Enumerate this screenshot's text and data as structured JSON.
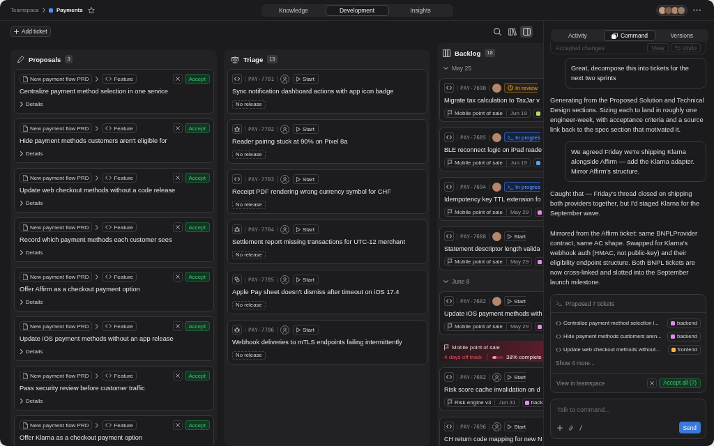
{
  "topbar": {
    "breadcrumb": [
      {
        "label": "Teamspace"
      },
      {
        "label": "Payments"
      }
    ],
    "starred": false,
    "tabs": [
      {
        "label": "Knowledge",
        "selected": false
      },
      {
        "label": "Development",
        "selected": true
      },
      {
        "label": "Insights",
        "selected": false
      }
    ]
  },
  "toolbar": {
    "add_ticket": "Add ticket",
    "panel_open": true
  },
  "columns": [
    {
      "kind": "proposals",
      "title": "Proposals",
      "count": "3",
      "cards": [
        {
          "source": "New payment flow PRD",
          "type": "Feature",
          "accept": "Accept",
          "title": "Centralize payment method selection in one service",
          "details": "Details",
          "expanded": false
        },
        {
          "source": "New payment flow PRD",
          "type": "Feature",
          "accept": "Accept",
          "title": "Hide payment methods customers aren't eligible for",
          "details": "Details",
          "expanded": false
        },
        {
          "source": "New payment flow PRD",
          "type": "Feature",
          "accept": "Accept",
          "title": "Update web checkout methods without a code release",
          "details": "Details",
          "expanded": false
        },
        {
          "source": "New payment flow PRD",
          "type": "Feature",
          "accept": "Accept",
          "title": "Record which payment methods each customer sees",
          "details": "Details",
          "expanded": false
        },
        {
          "source": "New payment flow PRD",
          "type": "Feature",
          "accept": "Accept",
          "title": "Offer Affirm as a checkout payment option",
          "details": "Details",
          "expanded": false
        },
        {
          "source": "New payment flow PRD",
          "type": "Feature",
          "accept": "Accept",
          "title": "Update iOS payment methods without an app release",
          "details": "Details",
          "expanded": false
        },
        {
          "source": "New payment flow PRD",
          "type": "Feature",
          "accept": "Accept",
          "title": "Pass security review before customer traffic",
          "details": "Details",
          "expanded": false
        },
        {
          "source": "New payment flow PRD",
          "type": "Feature",
          "accept": "Accept",
          "title": "Offer Klarna as a checkout payment option"
        }
      ]
    },
    {
      "kind": "triage",
      "title": "Triage",
      "count": "15",
      "cards": [
        {
          "kind": "feature",
          "id": "PAY-7701",
          "assigned": false,
          "status": {
            "kind": "start",
            "label": "Start"
          },
          "title": "Sync notification dashboard actions with app icon badge",
          "release": "No release"
        },
        {
          "kind": "bug",
          "id": "PAY-7702",
          "assigned": false,
          "status": {
            "kind": "start",
            "label": "Start"
          },
          "title": "Reader pairing stuck at 90% on Pixel 8a",
          "release": "No release"
        },
        {
          "kind": "feature",
          "id": "PAY-7703",
          "assigned": false,
          "status": {
            "kind": "start",
            "label": "Start"
          },
          "title": "Receipt PDF rendering wrong currency symbol for CHF",
          "release": "No release"
        },
        {
          "kind": "bug",
          "id": "PAY-7704",
          "assigned": false,
          "status": {
            "kind": "start",
            "label": "Start"
          },
          "title": "Settlement report missing transactions for UTC-12 merchant",
          "release": "No release"
        },
        {
          "kind": "chore",
          "id": "PAY-7705",
          "assigned": false,
          "status": {
            "kind": "start",
            "label": "Start"
          },
          "title": "Apple Pay sheet doesn't dismiss after timeout on iOS 17.4",
          "release": "No release"
        },
        {
          "kind": "bug",
          "id": "PAY-7706",
          "assigned": false,
          "status": {
            "kind": "start",
            "label": "Start"
          },
          "title": "Webhook deliveries to mTLS endpoints failing intermittently",
          "release": "No release"
        }
      ]
    },
    {
      "kind": "backlog",
      "title": "Backlog",
      "count": "18",
      "groups": [
        {
          "label": "May 25",
          "expanded": true,
          "items": [
            {
              "kind": "feature",
              "id": "PAY-7690",
              "assigned": true,
              "status": {
                "kind": "review",
                "label": "In review"
              },
              "title": "Migrate tax calculation to TaxJar v",
              "milestone": {
                "name": "Mobile point of sale",
                "date": "Jun 19"
              },
              "tag": {
                "color": "#b9dc6e"
              }
            },
            {
              "kind": "feature",
              "id": "PAY-7685",
              "assigned": true,
              "status": {
                "kind": "progress",
                "label": "In progres"
              },
              "title": "BLE reconnect logic on iPad reade",
              "milestone": {
                "name": "Mobile point of sale",
                "date": "Jun 19"
              },
              "tag": {
                "color": "#5b9df7"
              }
            },
            {
              "kind": "feature",
              "id": "PAY-7694",
              "assigned": true,
              "status": {
                "kind": "progress",
                "label": "In progres"
              },
              "title": "Idempotency key TTL extension fo",
              "milestone": {
                "name": "Mobile point of sale",
                "date": "May 29"
              },
              "tag": {
                "color": "#e28ee9"
              }
            },
            {
              "kind": "feature",
              "id": "PAY-7688",
              "assigned": true,
              "status": {
                "kind": "start",
                "label": "Start"
              },
              "title": "Statement descriptor length valida",
              "milestone": {
                "name": "Mobile point of sale",
                "date": "May 29"
              },
              "tag": {
                "color": "#e28ee9"
              }
            }
          ]
        },
        {
          "label": "June 8",
          "expanded": true,
          "items": [
            {
              "kind": "feature",
              "id": "PAY-7682",
              "assigned": true,
              "status": {
                "kind": "start",
                "label": "Start"
              },
              "title": "Update iOS payment methods with",
              "milestone": {
                "name": "Mobile point of sale",
                "date": "May 29"
              },
              "tag": {
                "color": "#e28ee9"
              }
            },
            {
              "kind": "milestone",
              "name": "Mobile point of sale",
              "off_track": "4 days off track",
              "progress": {
                "level": 0.38,
                "label": "38% complete"
              }
            },
            {
              "kind": "feature",
              "id": "PAY-7682",
              "assigned": false,
              "status": {
                "kind": "start",
                "label": "Start"
              },
              "title": "Risk score cache invalidation on d",
              "milestone": {
                "name": "Risk engine v3",
                "date": "Jun 31"
              },
              "tag": {
                "color": "#e28ee9",
                "label": "back"
              }
            },
            {
              "kind": "feature",
              "id": "PAY-7696",
              "assigned": false,
              "status": {
                "kind": "start",
                "label": "Start"
              },
              "title": "CH return code mapping for new N"
            }
          ]
        }
      ]
    }
  ],
  "panel": {
    "tabs": [
      {
        "label": "Activity",
        "selected": false
      },
      {
        "label": "Command",
        "selected": true
      },
      {
        "label": "Versions",
        "selected": false
      }
    ],
    "accepted": {
      "label": "Accepted changes",
      "view": "View",
      "undo": "Undo"
    },
    "messages": [
      {
        "kind": "user",
        "text": "Great, decompose this into tickets for the next two sprints"
      },
      {
        "kind": "assistant",
        "text": "Generating from the Proposed Solution and Technical Design sections. Sizing each to land in roughly one engineer-week, with acceptance criteria and a source link back to the spec section that motivated it."
      },
      {
        "kind": "user",
        "text": "We agreed Friday we're shipping Klarna alongside Affirm — add the Klarna adapter. Mirror Affirm's structure."
      },
      {
        "kind": "assistant",
        "text": "Caught that — Friday's thread closed on shipping both providers together, but I'd staged Klarna for the September wave."
      },
      {
        "kind": "assistant",
        "text": "Mirrored from the Affirm ticket: same BNPLProvider contract, same AC shape. Swapped for Klarna's webhook auth (HMAC, not public-key) and their eligibility endpoint structure. Both BNPL tickets are now cross-linked and slotted into the September launch milestone."
      }
    ],
    "proposal": {
      "title": "Proposed 7 tickets",
      "tickets": [
        {
          "title": "Centralize payment method selection i...",
          "label": "backend",
          "color": "#e28ee9"
        },
        {
          "title": "Hide payment methods customers aren...",
          "label": "backend",
          "color": "#e28ee9"
        },
        {
          "title": "Update web checkout methods without...",
          "label": "frontend",
          "color": "#f3b63f"
        }
      ],
      "more": "Show 4 more...",
      "link": "View in teamspace",
      "accept": "Accept all (7)"
    },
    "composer": {
      "placeholder": "Talk to command...",
      "send": "Send"
    }
  }
}
